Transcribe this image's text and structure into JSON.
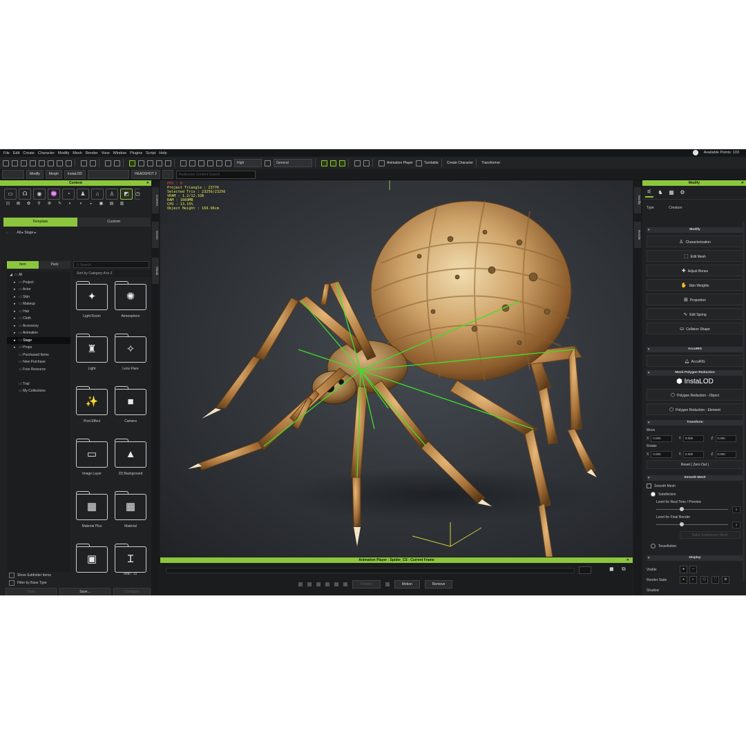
{
  "menu": [
    "File",
    "Edit",
    "Create",
    "Character",
    "Modify",
    "Mesh",
    "Render",
    "View",
    "Window",
    "Plugins",
    "Script",
    "Help"
  ],
  "available_points": "Available Points: 103",
  "toolbar": {
    "quality": "High",
    "shading": "General",
    "animation_player": "Animation Player",
    "turntable": "Turntable",
    "create_character": "Create Character",
    "transformer": "Transformer"
  },
  "toolbar2": {
    "modify": "Modify",
    "morph": "Morph",
    "instalod": "InstaLOD",
    "headshot": "HEADSHOT 2",
    "search_placeholder": "Reallusion Content Search"
  },
  "content_panel": {
    "title": "Content",
    "tabs": [
      "Template",
      "Custom"
    ],
    "breadcrumb": "All ▸ Stage ▸",
    "subtabs": [
      "Item",
      "Pack"
    ],
    "search_placeholder": "Search",
    "sort": "Sort by Category A to Z",
    "tree": [
      {
        "label": "All",
        "indent": 0,
        "arrow": "◢"
      },
      {
        "label": "Project",
        "indent": 1,
        "arrow": "▸"
      },
      {
        "label": "Actor",
        "indent": 1,
        "arrow": "▸"
      },
      {
        "label": "Skin",
        "indent": 1,
        "arrow": "▸"
      },
      {
        "label": "Makeup",
        "indent": 1,
        "arrow": "▸"
      },
      {
        "label": "Hair",
        "indent": 1,
        "arrow": "▸"
      },
      {
        "label": "Cloth",
        "indent": 1,
        "arrow": "▸"
      },
      {
        "label": "Accessory",
        "indent": 1,
        "arrow": "▸"
      },
      {
        "label": "Animation",
        "indent": 1,
        "arrow": "▸"
      },
      {
        "label": "Stage",
        "indent": 1,
        "arrow": "▸",
        "selected": true
      },
      {
        "label": "Props",
        "indent": 1,
        "arrow": "▸"
      },
      {
        "label": "Purchased Items",
        "indent": 1,
        "arrow": ""
      },
      {
        "label": "New Purchase",
        "indent": 1,
        "arrow": ""
      },
      {
        "label": "Free Resource",
        "indent": 1,
        "arrow": ""
      },
      {
        "label": "",
        "indent": 0,
        "arrow": ""
      },
      {
        "label": "Trial",
        "indent": 1,
        "arrow": ""
      },
      {
        "label": "My Collections",
        "indent": 1,
        "arrow": ""
      }
    ],
    "items": [
      {
        "label": "Light Room",
        "glyph": "✦"
      },
      {
        "label": "Atmosphere",
        "glyph": "✺"
      },
      {
        "label": "Light",
        "glyph": "♜"
      },
      {
        "label": "Lens Flare",
        "glyph": "✧"
      },
      {
        "label": "Post Effect",
        "glyph": "✨"
      },
      {
        "label": "Camera",
        "glyph": "■"
      },
      {
        "label": "Image Layer",
        "glyph": "▭"
      },
      {
        "label": "2D Background",
        "glyph": "▲"
      },
      {
        "label": "Material Plus",
        "glyph": "▦"
      },
      {
        "label": "Material",
        "glyph": "▦"
      },
      {
        "label": "",
        "glyph": "▣"
      },
      {
        "label": "",
        "glyph": "Ɪ"
      }
    ],
    "show_subfolder": "Show Subfolder Items",
    "filter_base": "Filter by Base Type",
    "total": "Total : 15",
    "buttons": [
      "Open",
      "Save...",
      "Configure"
    ]
  },
  "side_tabs": [
    "Content",
    "Scene",
    "Visual"
  ],
  "viewport_stats": [
    "FPS : 0",
    "Project Triangle : 23776",
    "Selected Tris : 23256/23256",
    "VRAM : 1.2/12.1GB",
    "RAM : 1669MB",
    "CPU : 13.15%",
    "Object Height : 169.96cm"
  ],
  "animation_player": {
    "title": "Animation Player : Spider_CS - Current Frame",
    "timeline_label": "Timeline",
    "motion": "Motion",
    "remove": "Remove"
  },
  "right_tabs": [
    "Modify",
    "Render"
  ],
  "modify_panel": {
    "title": "Modify",
    "type_label": "Type",
    "type_value": "Creature",
    "section_modify": "Modify",
    "buttons": [
      {
        "label": "Characterization",
        "icon": "♙"
      },
      {
        "label": "Edit Mesh",
        "icon": "⬚"
      },
      {
        "label": "Adjust Bones",
        "icon": "✚"
      },
      {
        "label": "Skin Weights",
        "icon": "✋"
      },
      {
        "label": "Proportion",
        "icon": "⊞"
      },
      {
        "label": "Edit Spring",
        "icon": "∿"
      },
      {
        "label": "Collision Shape",
        "icon": "⛀"
      }
    ],
    "section_accurig": "AccuRIG",
    "accurig_button": "AccuRIG",
    "section_reduction": "Mesh Polygon Reduction",
    "instalod_logo": "InstaLOD",
    "reduction_buttons": [
      "Polygon Reduction - Object",
      "Polygon Reduction - Element"
    ],
    "section_transform": "Transform",
    "move_label": "Move",
    "rotate_label": "Rotate",
    "axes": [
      "X",
      "Y",
      "Z"
    ],
    "move": [
      "0.000",
      "0.000",
      "0.000"
    ],
    "rotate": [
      "0.000",
      "0.000",
      "0.000"
    ],
    "reset_button": "Reset ( Zero Out )",
    "section_smooth": "Smooth Mesh",
    "smooth_mesh": "Smooth Mesh",
    "subdivision": "Subdivision",
    "level_realtime": "Level for Real Time / Preview",
    "level_realtime_value": "1",
    "level_final": "Level for Final Render",
    "level_final_value": "1",
    "bake_button": "Bake Subdivision Mesh",
    "tessellation": "Tessellation",
    "section_display": "Display",
    "visible": "Visible",
    "render_state": "Render State",
    "shadow": "Shadow"
  },
  "colors": {
    "accent": "#8cc63e",
    "viewport_bg": "#3a3e44",
    "stats_text": "#e9e95a"
  }
}
